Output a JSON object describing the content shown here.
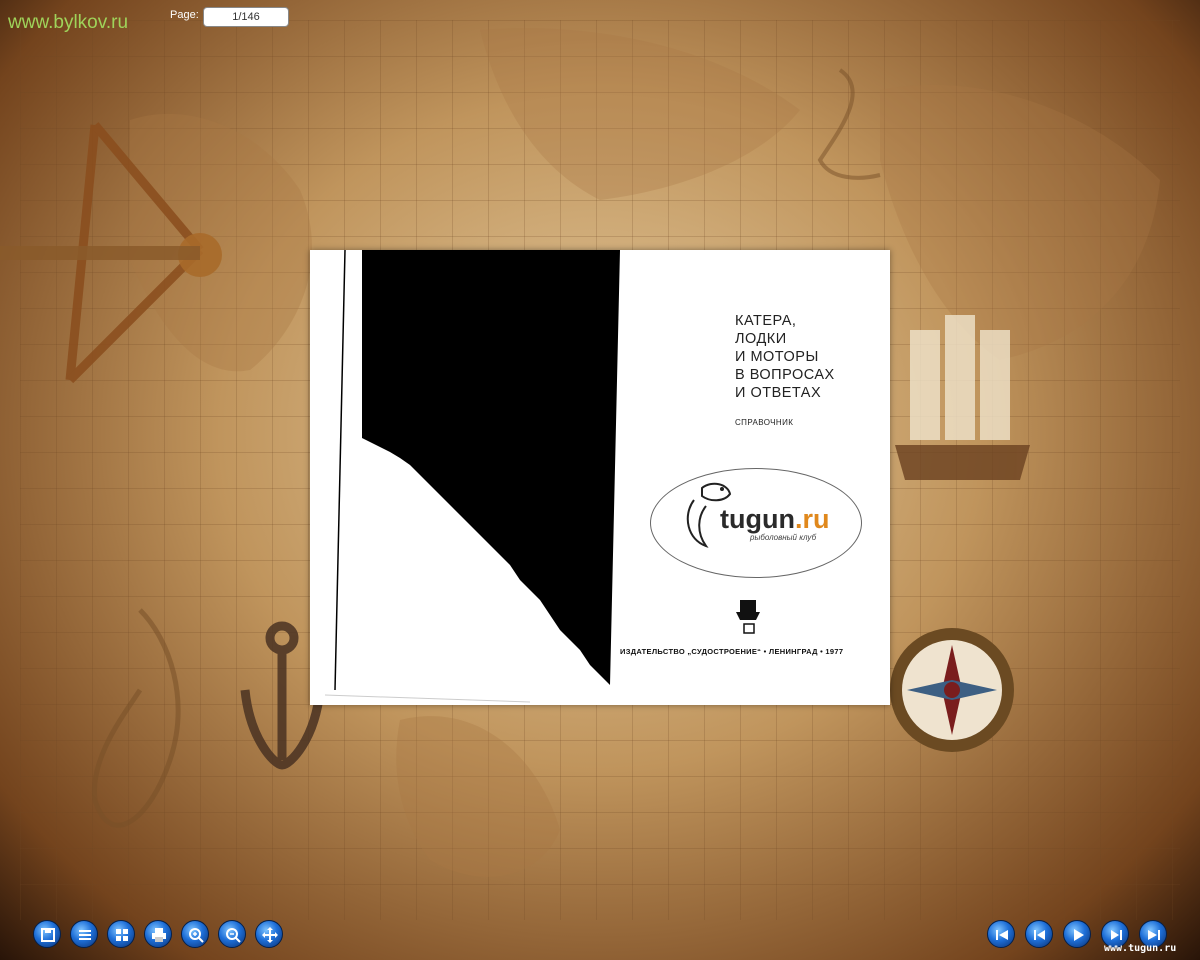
{
  "site_link": "www.bylkov.ru",
  "page": {
    "label": "Page:",
    "value": "1/146"
  },
  "book": {
    "title_lines": "КАТЕРА,\nЛОДКИ\nИ МОТОРЫ\nВ ВОПРОСАХ\nИ ОТВЕТАХ",
    "subtitle": "СПРАВОЧНИК",
    "publisher": "ИЗДАТЕЛЬСТВО „СУДОСТРОЕНИЕ“ • ЛЕНИНГРАД • 1977",
    "logo": {
      "text_main": "tugun",
      "text_suffix": ".ru",
      "tagline": "рыболовный клуб"
    }
  },
  "toolbar_left": [
    {
      "icon": "save-icon"
    },
    {
      "icon": "table-of-contents-icon"
    },
    {
      "icon": "thumbnails-icon"
    },
    {
      "icon": "print-icon"
    },
    {
      "icon": "zoom-in-icon"
    },
    {
      "icon": "zoom-out-icon"
    },
    {
      "icon": "move-icon"
    }
  ],
  "toolbar_right": [
    {
      "icon": "first-page-icon"
    },
    {
      "icon": "previous-page-icon"
    },
    {
      "icon": "play-icon"
    },
    {
      "icon": "next-page-icon"
    },
    {
      "icon": "last-page-icon"
    }
  ],
  "watermark": "www.tugun.ru",
  "colors": {
    "link": "#9fd35a",
    "button": "#1e6fd8",
    "logo_accent": "#e0881c"
  }
}
